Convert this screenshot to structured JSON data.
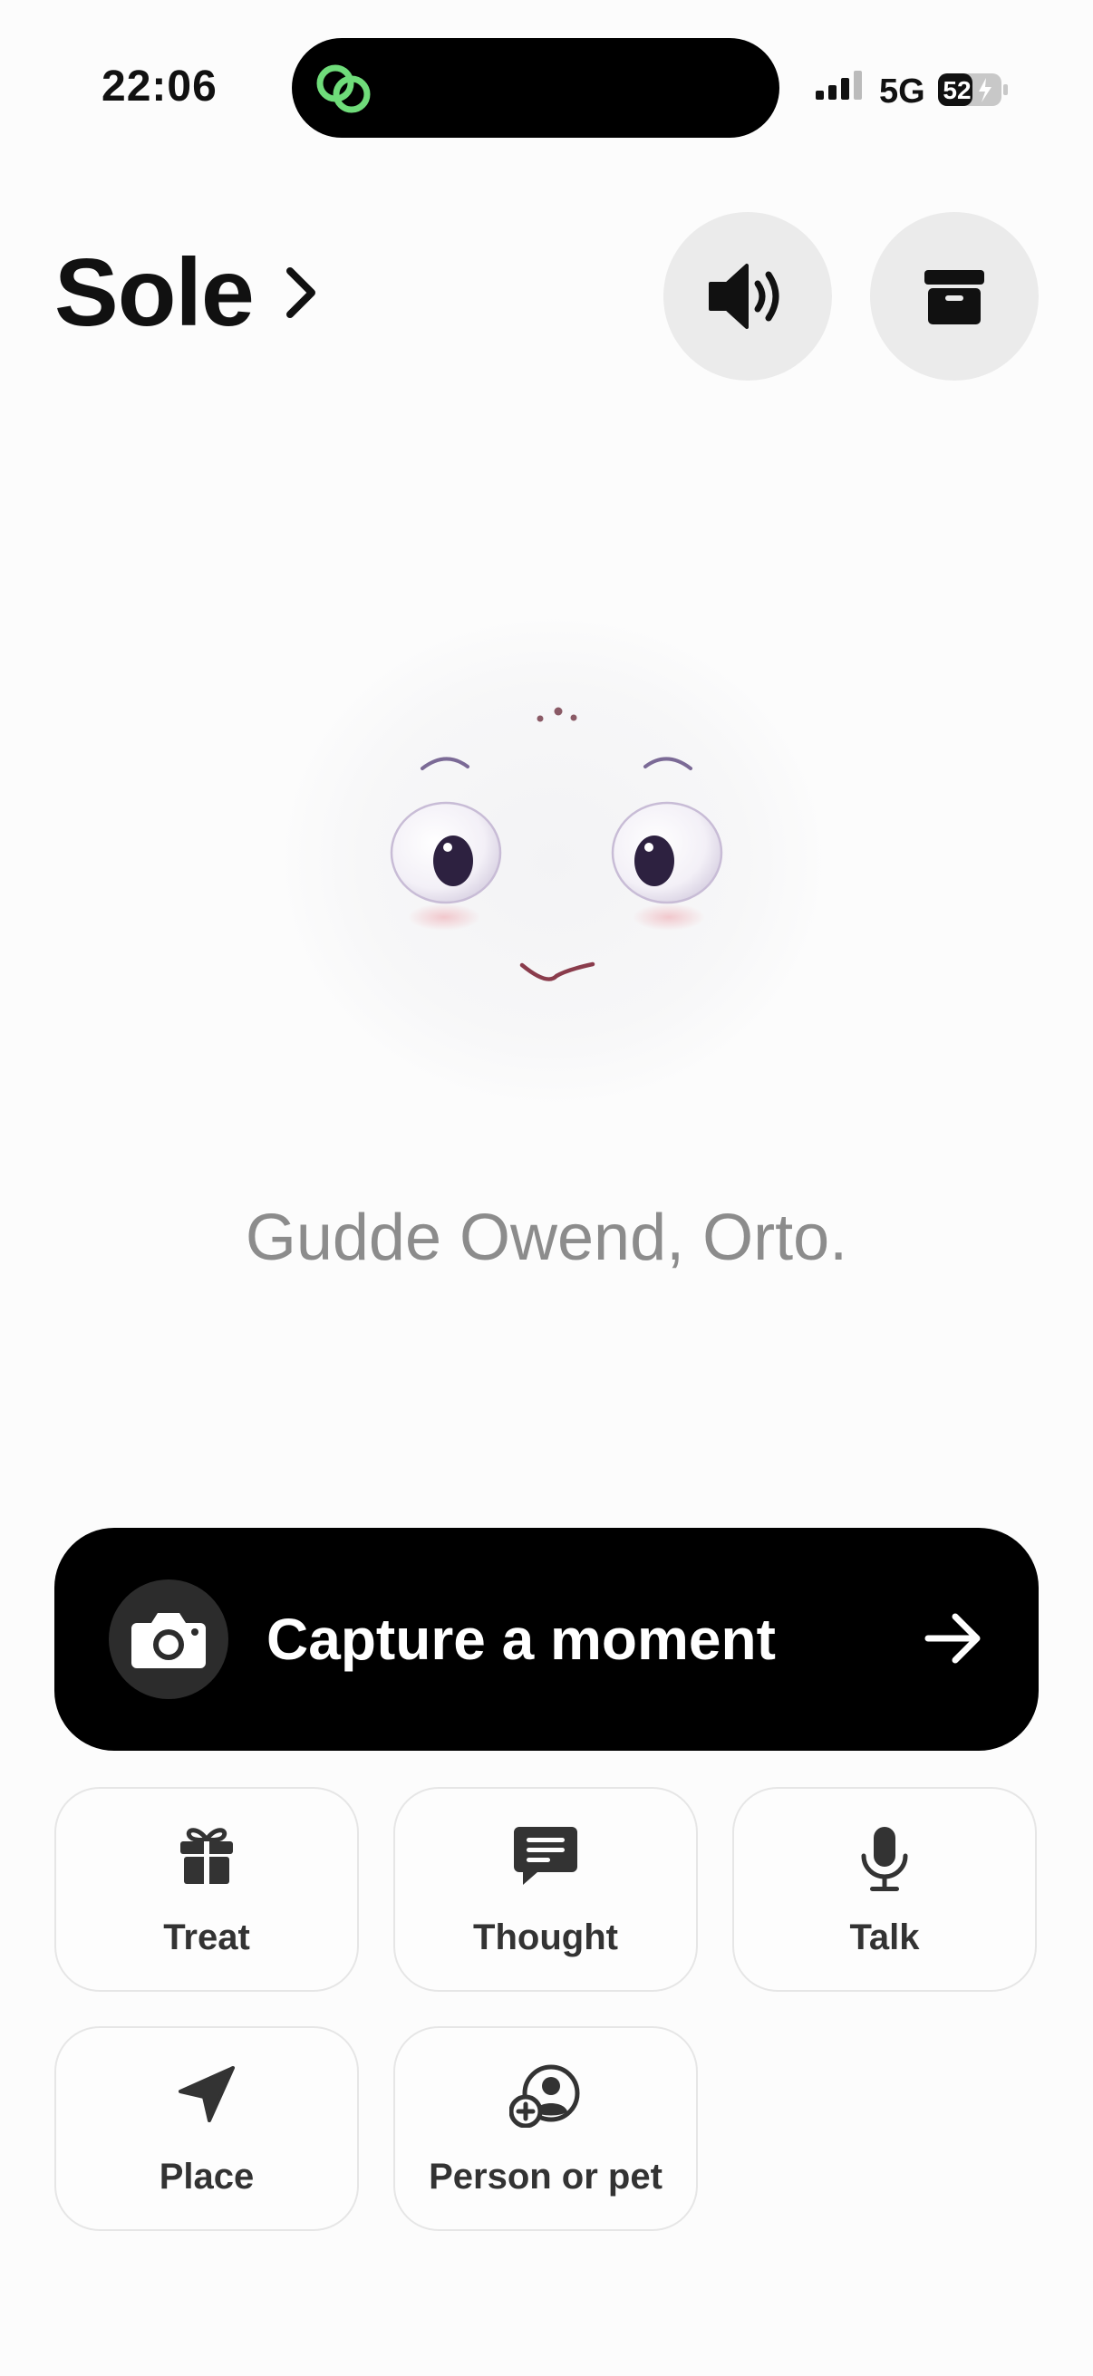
{
  "status_bar": {
    "time": "22:06",
    "network": "5G",
    "battery": "52"
  },
  "header": {
    "title": "Sole"
  },
  "greeting": "Gudde Owend, Orto.",
  "capture": {
    "label": "Capture a moment"
  },
  "actions": [
    {
      "label": "Treat",
      "icon": "gift-icon"
    },
    {
      "label": "Thought",
      "icon": "chat-bubble-icon"
    },
    {
      "label": "Talk",
      "icon": "microphone-icon"
    },
    {
      "label": "Place",
      "icon": "location-arrow-icon"
    },
    {
      "label": "Person or pet",
      "icon": "add-person-icon"
    }
  ],
  "colors": {
    "island_icon": "#6fdc7a",
    "capture_bg": "#000000",
    "greeting": "#8c8c8c",
    "circle_button": "#ebebeb"
  }
}
